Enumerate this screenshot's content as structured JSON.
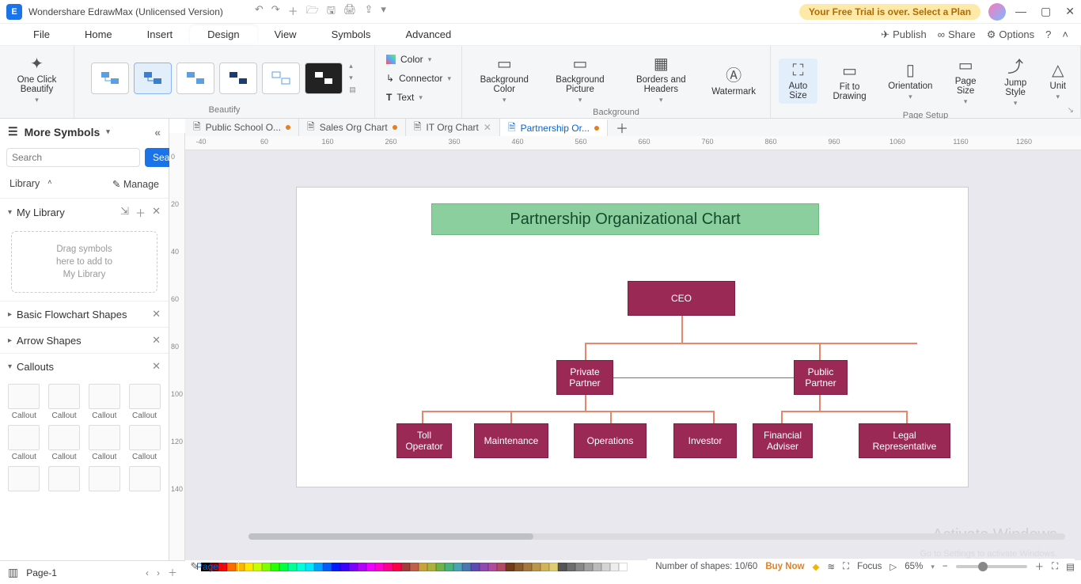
{
  "app": {
    "title": "Wondershare EdrawMax (Unlicensed Version)",
    "trial_notice": "Your Free Trial is over. Select a Plan"
  },
  "menubar": {
    "items": [
      "File",
      "Home",
      "Insert",
      "Design",
      "View",
      "Symbols",
      "Advanced"
    ],
    "active_index": 3,
    "right": {
      "publish": "Publish",
      "share": "Share",
      "options": "Options"
    }
  },
  "ribbon": {
    "beautify": {
      "one_click": "One Click\nBeautify",
      "label": "Beautify"
    },
    "props": {
      "color": "Color",
      "connector": "Connector",
      "text": "Text"
    },
    "background": {
      "bg_color": "Background Color",
      "bg_picture": "Background Picture",
      "borders": "Borders and Headers",
      "watermark": "Watermark",
      "label": "Background"
    },
    "pagesetup": {
      "auto_size": "Auto Size",
      "fit": "Fit to Drawing",
      "orientation": "Orientation",
      "page_size": "Page Size",
      "jump_style": "Jump Style",
      "unit": "Unit",
      "label": "Page Setup"
    }
  },
  "doctabs": [
    {
      "label": "Public School O...",
      "modified": true,
      "active": false
    },
    {
      "label": "Sales Org Chart",
      "modified": true,
      "active": false
    },
    {
      "label": "IT Org Chart",
      "modified": false,
      "active": false
    },
    {
      "label": "Partnership Or...",
      "modified": true,
      "active": true
    }
  ],
  "hruler_ticks": [
    -40,
    10,
    60,
    110,
    160,
    210,
    260,
    310,
    360,
    410,
    460,
    510,
    560,
    610,
    660,
    710,
    760,
    810,
    860,
    910,
    960,
    1010,
    1060,
    1110,
    1160,
    1210,
    1260,
    1310
  ],
  "hruler_labels": [
    "-40",
    "",
    "60",
    "",
    "160",
    "",
    "260",
    "",
    "360",
    "",
    "460",
    "",
    "560",
    "",
    "660",
    "",
    "760",
    "",
    "860",
    "",
    "960",
    "",
    "1060",
    "",
    "1160",
    "",
    "1260",
    ""
  ],
  "vruler_ticks": [
    0,
    20,
    40,
    60,
    80,
    100,
    120,
    140
  ],
  "leftpanel": {
    "header": "More Symbols",
    "search_placeholder": "Search",
    "search_btn": "Search",
    "library": "Library",
    "manage": "Manage",
    "mylib": "My Library",
    "mylib_hint": "Drag symbols\nhere to add to\nMy Library",
    "basic_shapes": "Basic Flowchart Shapes",
    "arrow_shapes": "Arrow Shapes",
    "callouts": "Callouts",
    "callout_label": "Callout"
  },
  "chart_data": {
    "type": "org-chart",
    "title": "Partnership Organizational Chart",
    "nodes": {
      "ceo": "CEO",
      "private": "Private Partner",
      "public": "Public Partner",
      "toll": "Toll Operator",
      "maint": "Maintenance",
      "ops": "Operations",
      "inv": "Investor",
      "fin": "Financial Adviser",
      "legal": "Legal Representative"
    },
    "edges": [
      [
        "ceo",
        "private"
      ],
      [
        "ceo",
        "public"
      ],
      [
        "private",
        "toll"
      ],
      [
        "private",
        "maint"
      ],
      [
        "private",
        "ops"
      ],
      [
        "private",
        "inv"
      ],
      [
        "public",
        "fin"
      ],
      [
        "public",
        "legal"
      ],
      [
        "private",
        "public"
      ]
    ],
    "colors": {
      "node_fill": "#9a2a55",
      "node_text": "#ffffff",
      "title_fill": "#8bcf9e",
      "connector": "#e8866b"
    }
  },
  "palette_colors": [
    "#000000",
    "#7f0000",
    "#ff0000",
    "#ff6a00",
    "#ffb400",
    "#ffe600",
    "#c8ff00",
    "#80ff00",
    "#2aff00",
    "#00ff3c",
    "#00ff94",
    "#00ffd8",
    "#00e6ff",
    "#00a2ff",
    "#005cff",
    "#001aff",
    "#3c00ff",
    "#7a00ff",
    "#b400ff",
    "#ee00ff",
    "#ff00d0",
    "#ff008c",
    "#ff0048",
    "#a33a3a",
    "#c06048",
    "#c8a23a",
    "#aab23a",
    "#6fb24a",
    "#49b27c",
    "#49a3b2",
    "#4a77b2",
    "#5d4ab2",
    "#8c4ab2",
    "#b24a9e",
    "#b24a66",
    "#703c1a",
    "#8a5a2a",
    "#a3783a",
    "#bb964a",
    "#d1b45a",
    "#e1cc72",
    "#555555",
    "#6e6e6e",
    "#888888",
    "#a1a1a1",
    "#bbbbbb",
    "#d4d4d4",
    "#ededed",
    "#ffffff"
  ],
  "footer": {
    "page_name": "Page-1",
    "active_page": "Page-1",
    "shapes": "Number of shapes: 10/60",
    "buy": "Buy Now",
    "focus": "Focus",
    "zoom": "65%"
  },
  "watermark": {
    "big": "Activate Windows",
    "small": "Go to Settings to activate Windows."
  }
}
